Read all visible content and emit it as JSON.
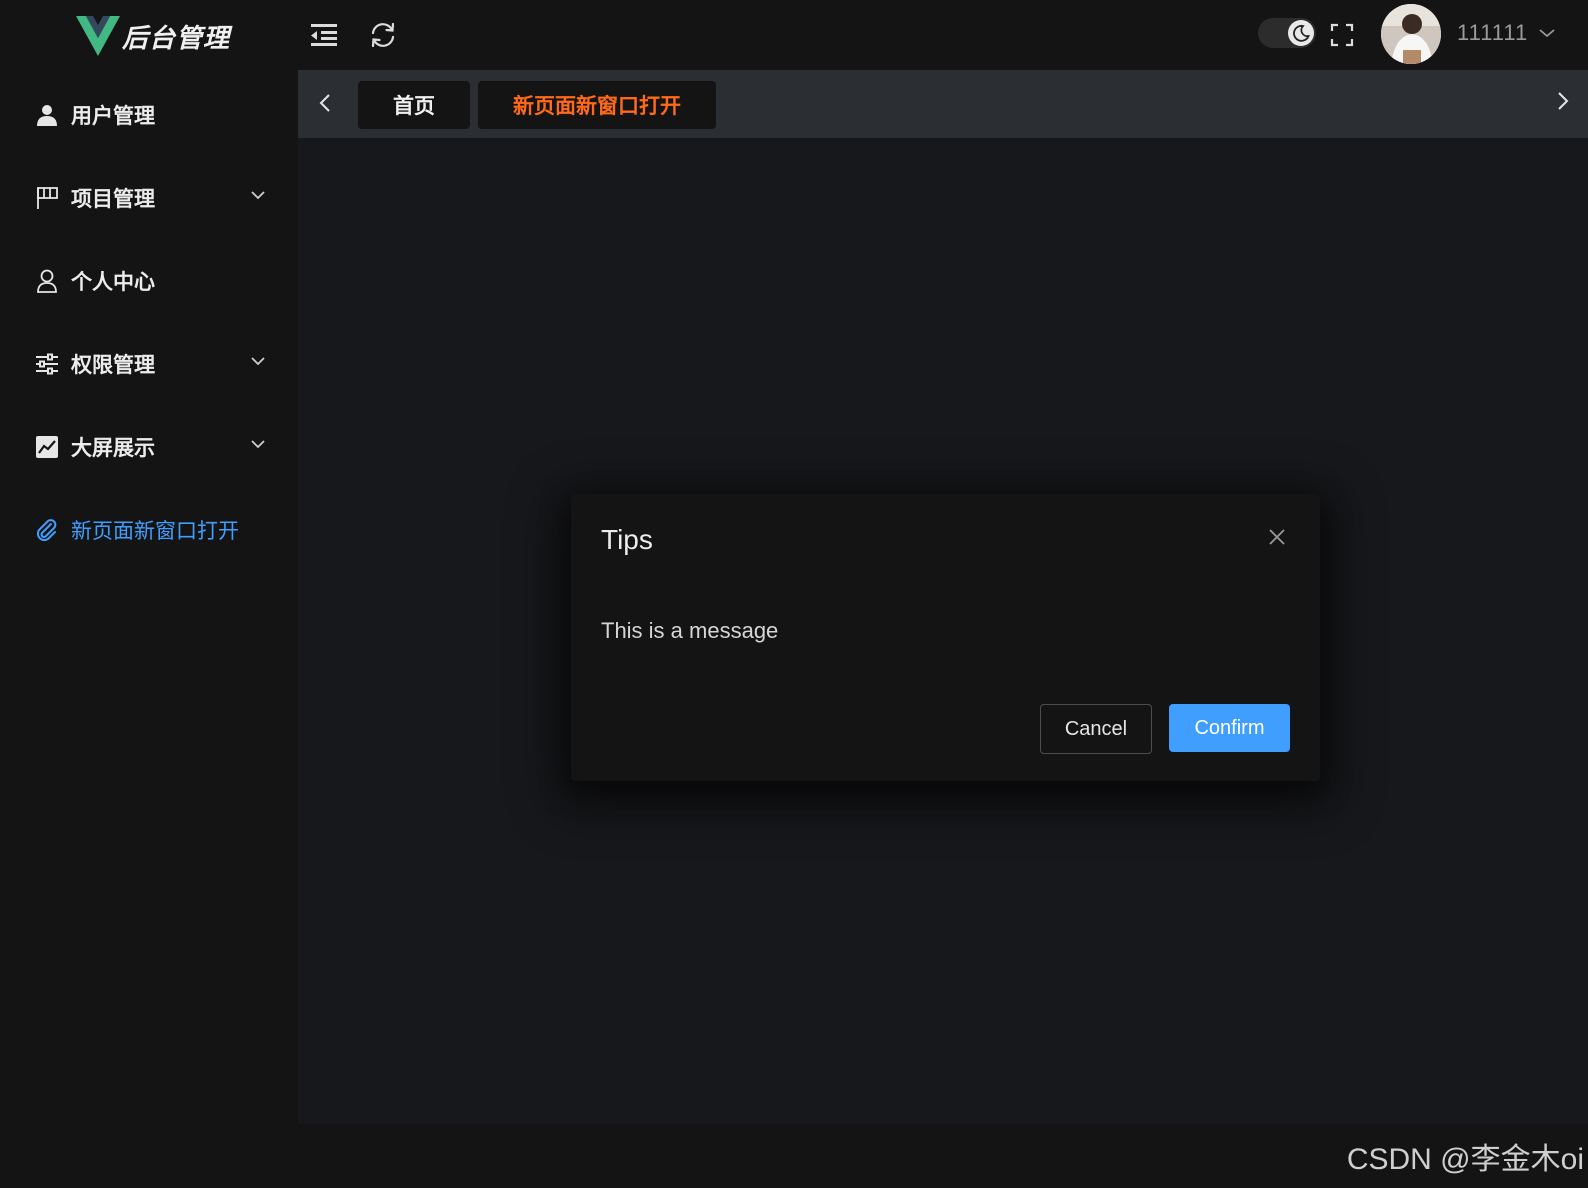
{
  "header": {
    "logo_title": "后台管理",
    "collapse_icon": "menu-fold-icon",
    "refresh_icon": "refresh-icon",
    "theme_icon": "moon-icon",
    "fullscreen_icon": "fullscreen-icon",
    "username": "111111"
  },
  "sidebar": {
    "items": [
      {
        "label": "用户管理",
        "icon": "user-filled-icon",
        "has_submenu": false
      },
      {
        "label": "项目管理",
        "icon": "flag-icon",
        "has_submenu": true
      },
      {
        "label": "个人中心",
        "icon": "user-icon",
        "has_submenu": false
      },
      {
        "label": "权限管理",
        "icon": "operation-icon",
        "has_submenu": true
      },
      {
        "label": "大屏展示",
        "icon": "data-line-icon",
        "has_submenu": true
      },
      {
        "label": "新页面新窗口打开",
        "icon": "paperclip-icon",
        "has_submenu": false,
        "active": true
      }
    ]
  },
  "tabs": [
    {
      "label": "首页",
      "active": false
    },
    {
      "label": "新页面新窗口打开",
      "active": true
    }
  ],
  "dialog": {
    "title": "Tips",
    "message": "This is a message",
    "cancel_label": "Cancel",
    "confirm_label": "Confirm"
  },
  "watermark": "CSDN @李金木oi",
  "colors": {
    "accent": "#409eff",
    "active_tab": "#ff6a1a",
    "logo_green": "#42b883",
    "logo_dark": "#35495e"
  }
}
